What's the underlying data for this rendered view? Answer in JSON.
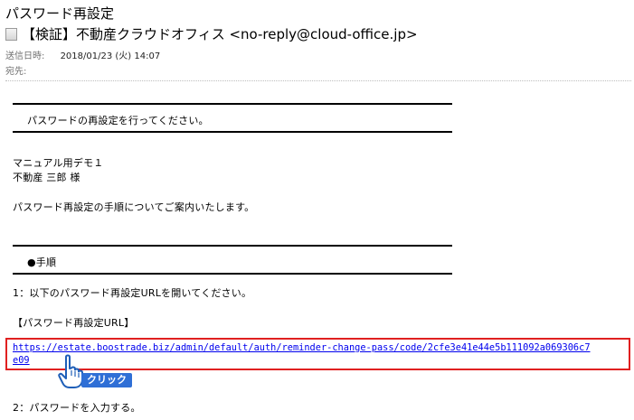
{
  "email": {
    "subject": "パスワード再設定",
    "from": "【検証】不動産クラウドオフィス <no-reply@cloud-office.jp>",
    "sent_label": "送信日時:",
    "sent_value": "2018/01/23 (火) 14:07",
    "to_label": "宛先:"
  },
  "body": {
    "banner1": "パスワードの再設定を行ってください。",
    "name1": "マニュアル用デモ１",
    "name2": "不動産 三郎 様",
    "intro": "パスワード再設定の手順についてご案内いたします。",
    "section_title": "●手順",
    "step1": "1：以下のパスワード再設定URLを開いてください。",
    "url_heading": "【パスワード再設定URL】",
    "url_line1": "https://estate.boostrade.biz/admin/default/auth/reminder-change-pass/code/2cfe3e41e44e5b111092a069306c7",
    "url_line2": "e09",
    "step2": "2：パスワードを入力する。"
  },
  "annotation": {
    "click_label": "クリック",
    "hand_icon": "pointing-hand-icon"
  },
  "colors": {
    "link": "#0000ee",
    "highlight_border": "#e02020",
    "badge": "#2f6fd6"
  }
}
